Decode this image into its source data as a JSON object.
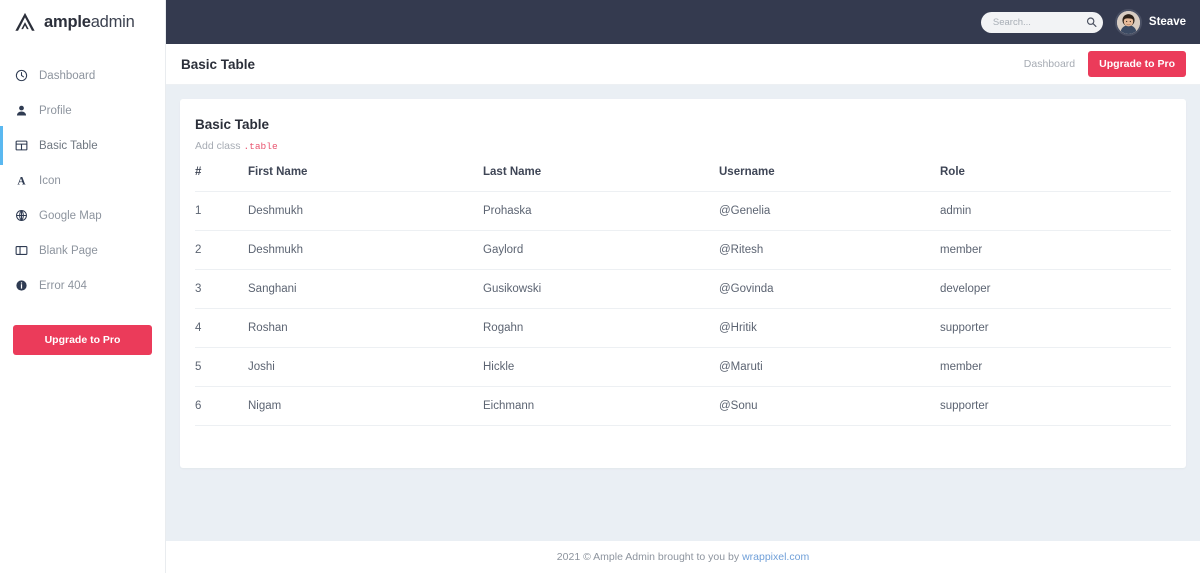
{
  "sidebar": {
    "brand": {
      "bold": "ample",
      "light": "admin",
      "logo_icon": "triangle-a-logo-icon"
    },
    "items": [
      {
        "label": "Dashboard",
        "icon": "clock-icon",
        "active": false
      },
      {
        "label": "Profile",
        "icon": "user-icon",
        "active": false
      },
      {
        "label": "Basic Table",
        "icon": "table-grid-icon",
        "active": true
      },
      {
        "label": "Icon",
        "icon": "letter-a-icon",
        "active": false
      },
      {
        "label": "Google Map",
        "icon": "globe-icon",
        "active": false
      },
      {
        "label": "Blank Page",
        "icon": "columns-icon",
        "active": false
      },
      {
        "label": "Error 404",
        "icon": "info-circle-icon",
        "active": false
      }
    ],
    "upgrade_label": "Upgrade to Pro"
  },
  "topbar": {
    "search": {
      "placeholder": "Search...",
      "value": "",
      "icon": "search-icon"
    },
    "user": {
      "name": "Steave",
      "avatar_icon": "user-avatar-photo"
    }
  },
  "page_head": {
    "title": "Basic Table",
    "breadcrumb": "Dashboard",
    "upgrade_label": "Upgrade to Pro"
  },
  "card": {
    "title": "Basic Table",
    "subtitle_prefix": "Add class",
    "subtitle_code": ".table",
    "table": {
      "columns": [
        "#",
        "First Name",
        "Last Name",
        "Username",
        "Role"
      ],
      "rows": [
        {
          "idx": "1",
          "first": "Deshmukh",
          "last": "Prohaska",
          "username": "@Genelia",
          "role": "admin"
        },
        {
          "idx": "2",
          "first": "Deshmukh",
          "last": "Gaylord",
          "username": "@Ritesh",
          "role": "member"
        },
        {
          "idx": "3",
          "first": "Sanghani",
          "last": "Gusikowski",
          "username": "@Govinda",
          "role": "developer"
        },
        {
          "idx": "4",
          "first": "Roshan",
          "last": "Rogahn",
          "username": "@Hritik",
          "role": "supporter"
        },
        {
          "idx": "5",
          "first": "Joshi",
          "last": "Hickle",
          "username": "@Maruti",
          "role": "member"
        },
        {
          "idx": "6",
          "first": "Nigam",
          "last": "Eichmann",
          "username": "@Sonu",
          "role": "supporter"
        }
      ]
    }
  },
  "footer": {
    "text": "2021 © Ample Admin brought to you by",
    "link": "wrappixel.com"
  },
  "colors": {
    "accent_red": "#eb3b5a",
    "topbar_dark": "#343a4f",
    "page_bg": "#eaeff4",
    "active_indicator": "#5ab8f0",
    "code_red": "#e8546f",
    "link_blue": "#6f9fd8"
  }
}
